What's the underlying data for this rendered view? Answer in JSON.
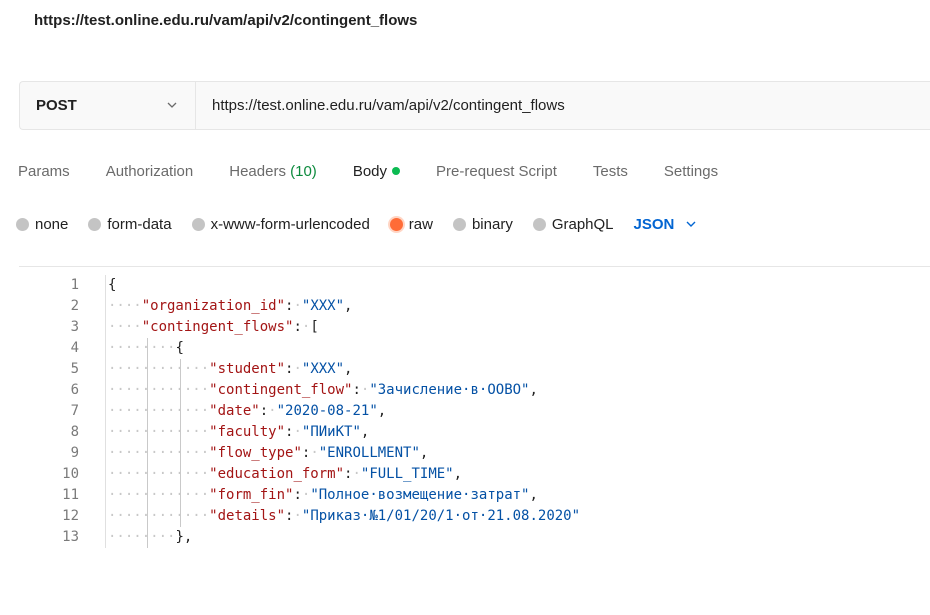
{
  "page_url": "https://test.online.edu.ru/vam/api/v2/contingent_flows",
  "request": {
    "method": "POST",
    "url": "https://test.online.edu.ru/vam/api/v2/contingent_flows"
  },
  "tabs": [
    {
      "label": "Params"
    },
    {
      "label": "Authorization"
    },
    {
      "label": "Headers",
      "count": "(10)"
    },
    {
      "label": "Body",
      "active": true
    },
    {
      "label": "Pre-request Script"
    },
    {
      "label": "Tests"
    },
    {
      "label": "Settings"
    }
  ],
  "body_types": [
    "none",
    "form-data",
    "x-www-form-urlencoded",
    "raw",
    "binary",
    "GraphQL"
  ],
  "body_type_selected": "raw",
  "language": "JSON",
  "colors": {
    "accent_orange": "#ff6c37",
    "status_green": "#0cbb52",
    "link_blue": "#0265d2"
  },
  "code_lines": [
    {
      "n": "1"
    },
    {
      "n": "2",
      "key": "\"organization_id\"",
      "value": "\"XXX\""
    },
    {
      "n": "3",
      "key": "\"contingent_flows\""
    },
    {
      "n": "4"
    },
    {
      "n": "5",
      "key": "\"student\"",
      "value": "\"XXX\""
    },
    {
      "n": "6",
      "key": "\"contingent_flow\"",
      "value": "\"Зачисление в ООВО\""
    },
    {
      "n": "7",
      "key": "\"date\"",
      "value": "\"2020-08-21\""
    },
    {
      "n": "8",
      "key": "\"faculty\"",
      "value": "\"ПИиКТ\""
    },
    {
      "n": "9",
      "key": "\"flow_type\"",
      "value": "\"ENROLLMENT\""
    },
    {
      "n": "10",
      "key": "\"education_form\"",
      "value": "\"FULL_TIME\""
    },
    {
      "n": "11",
      "key": "\"form_fin\"",
      "value": "\"Полное возмещение затрат\""
    },
    {
      "n": "12",
      "key": "\"details\"",
      "value": "\"Приказ №1/01/20/1 от 21.08.2020\""
    },
    {
      "n": "13"
    }
  ]
}
